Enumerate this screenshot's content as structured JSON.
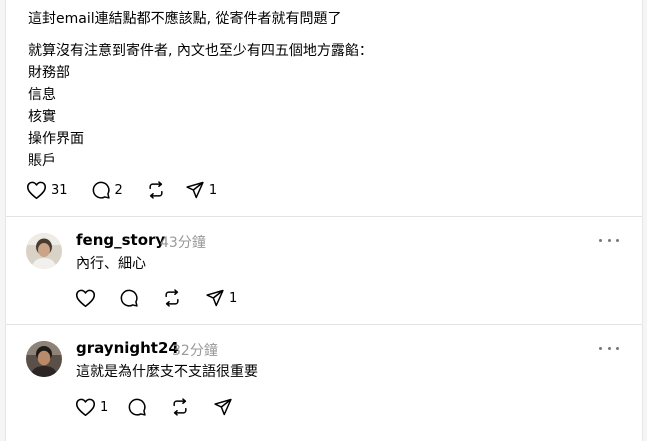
{
  "post": {
    "text_line1": "這封email連結點都不應該點, 從寄件者就有問題了",
    "text_line2": "就算沒有注意到寄件者, 內文也至少有四五個地方露餡：",
    "list": [
      "財務部",
      "信息",
      "核實",
      "操作界面",
      "賬戶"
    ],
    "likes": "31",
    "replies": "2",
    "shares": "1"
  },
  "replies": [
    {
      "username": "feng_story",
      "time": "43分鐘",
      "text": "內行、細心",
      "likes": "",
      "replies": "",
      "shares": "1"
    },
    {
      "username": "graynight24",
      "time": "32分鐘",
      "text": "這就是為什麼支不支語很重要",
      "likes": "1",
      "replies": "",
      "shares": ""
    }
  ],
  "colors": {
    "text": "#000000",
    "meta": "#999999",
    "divider": "#e3e3e3",
    "background": "#ffffff"
  }
}
